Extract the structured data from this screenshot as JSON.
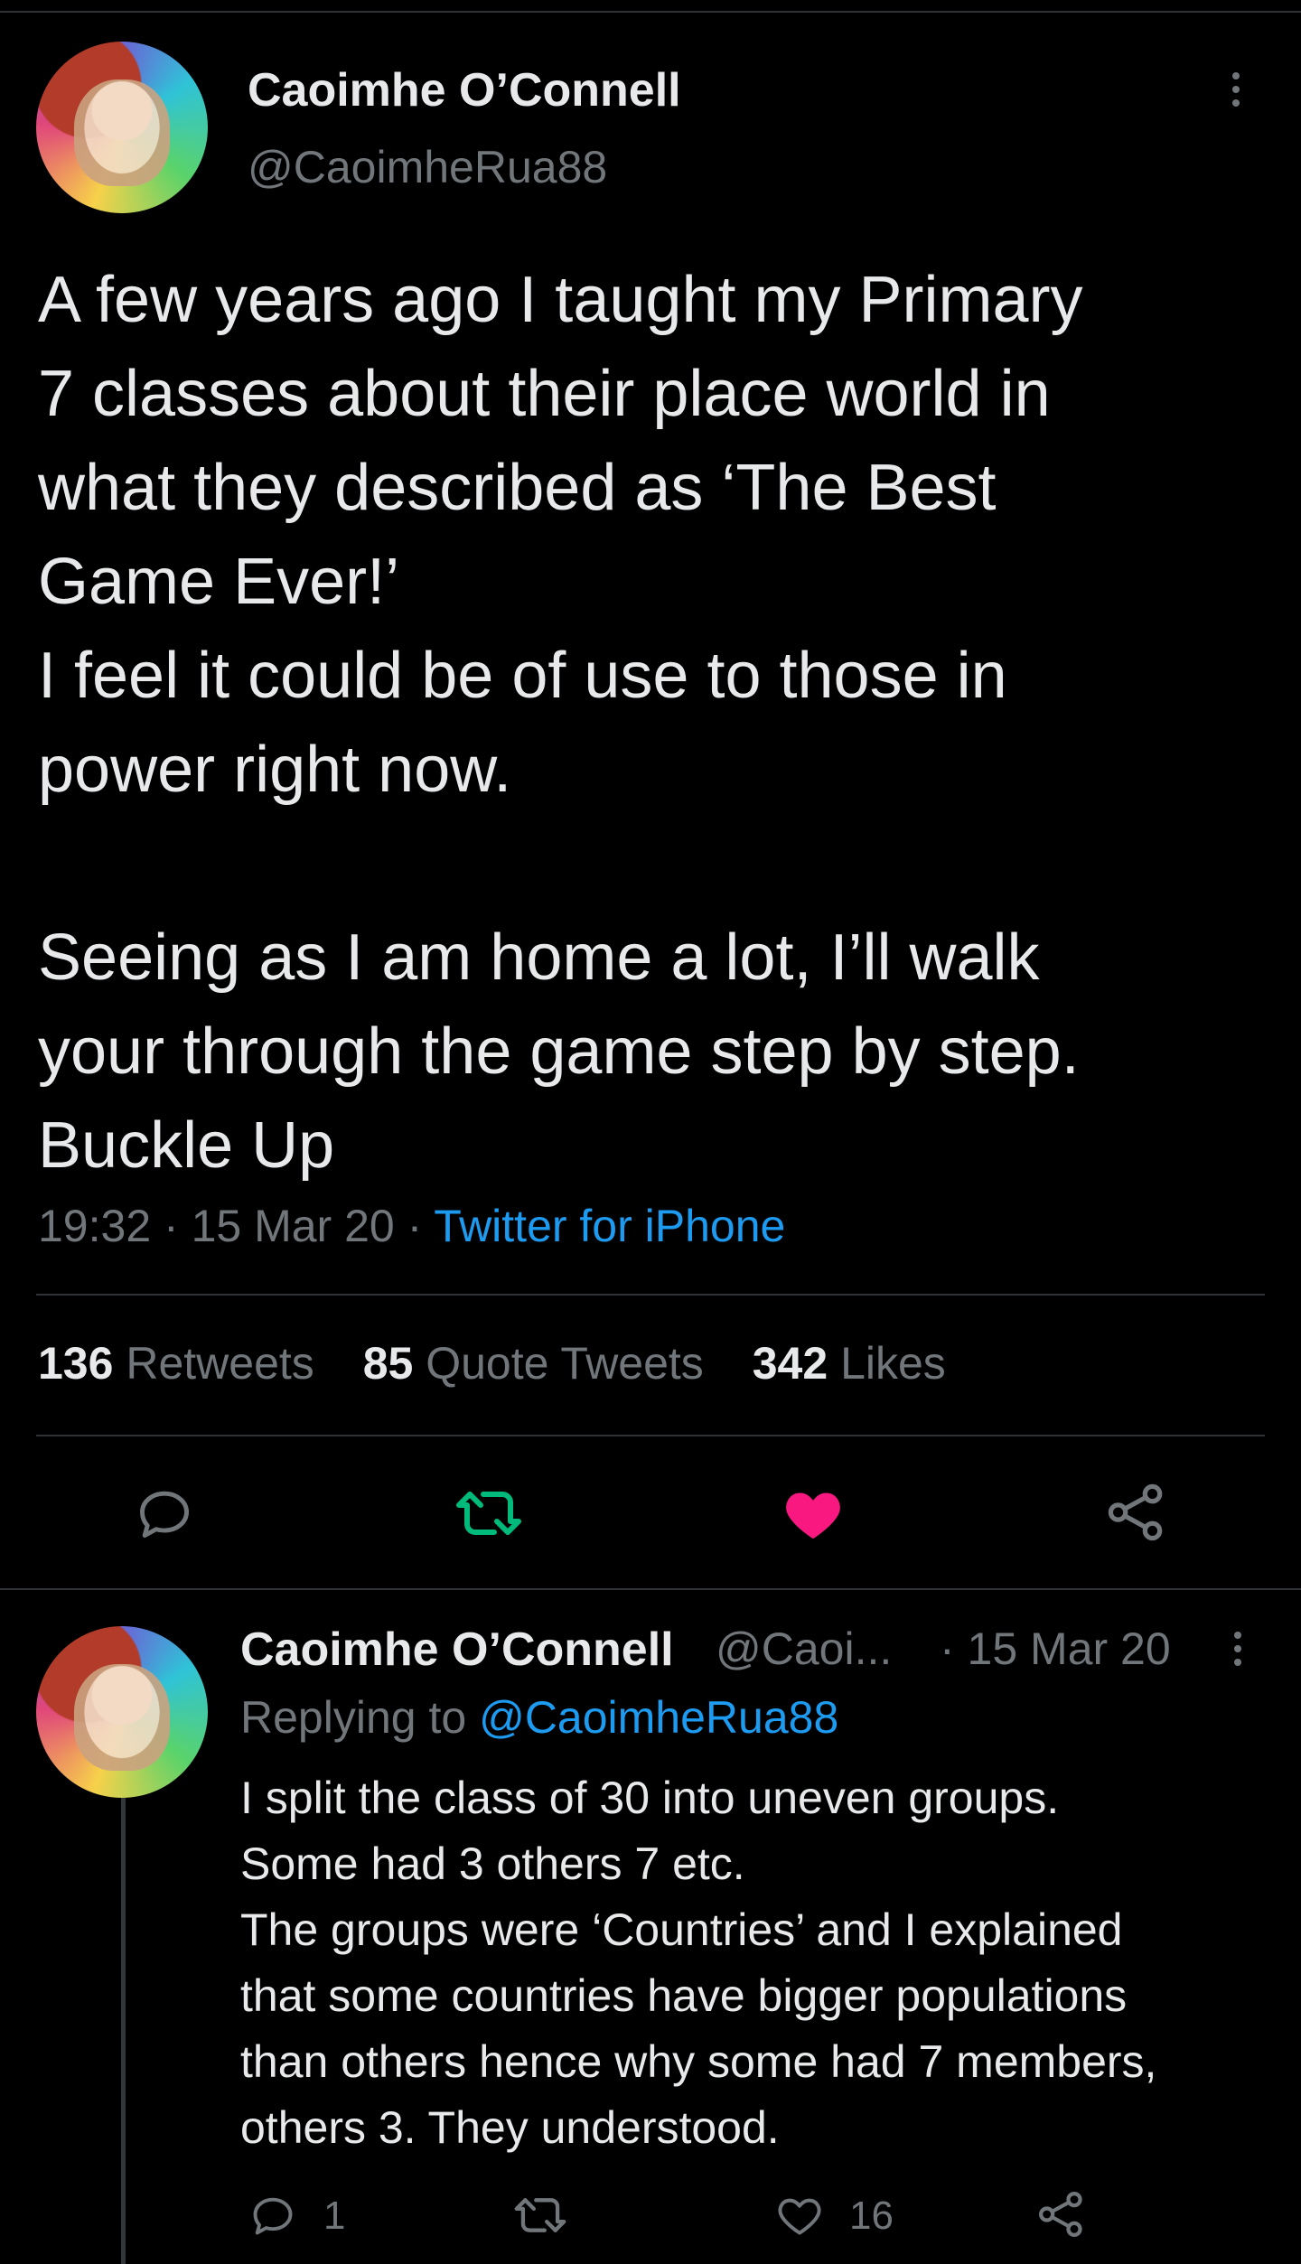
{
  "main_tweet": {
    "display_name": "Caoimhe O’Connell",
    "handle": "@CaoimheRua88",
    "text_lines": [
      "A few years ago I taught my Primary",
      "7 classes about their place world in",
      "what they described as ‘The Best",
      "Game Ever!’",
      "I feel it could be of use to those in",
      "power right now."
    ],
    "text_lines_2": [
      "Seeing as I am home a lot, I’ll walk",
      "your through the game step by step.",
      "Buckle Up"
    ],
    "time": "19:32",
    "date": "15 Mar 20",
    "separator": "·",
    "source": "Twitter for iPhone",
    "stats": {
      "retweets_count": "136",
      "retweets_label": "Retweets",
      "quotes_count": "85",
      "quotes_label": "Quote Tweets",
      "likes_count": "342",
      "likes_label": "Likes"
    },
    "icons": {
      "reply": "reply-icon",
      "retweet": "retweet-icon",
      "like": "like-icon",
      "share": "share-icon"
    },
    "colors": {
      "retweet": "#00ba7c",
      "like": "#f91880"
    }
  },
  "reply_tweet": {
    "display_name": "Caoimhe O’Connell",
    "handle_truncated": "@Caoi...",
    "date": "· 15 Mar 20",
    "replying_to_label": "Replying to",
    "replying_to_handle": "@CaoimheRua88",
    "text_lines": [
      "I split the class of 30 into uneven groups.",
      "Some had 3 others 7 etc.",
      "The groups were ‘Countries’ and I explained",
      "that some countries have bigger populations",
      "than others hence why some had 7 members,",
      "others 3. They understood."
    ],
    "reply_count": "1",
    "like_count": "16"
  },
  "colors": {
    "background": "#000000",
    "text": "#e7e9ea",
    "muted": "#71767b",
    "accent": "#1d9bf0",
    "divider": "#2f3336"
  }
}
